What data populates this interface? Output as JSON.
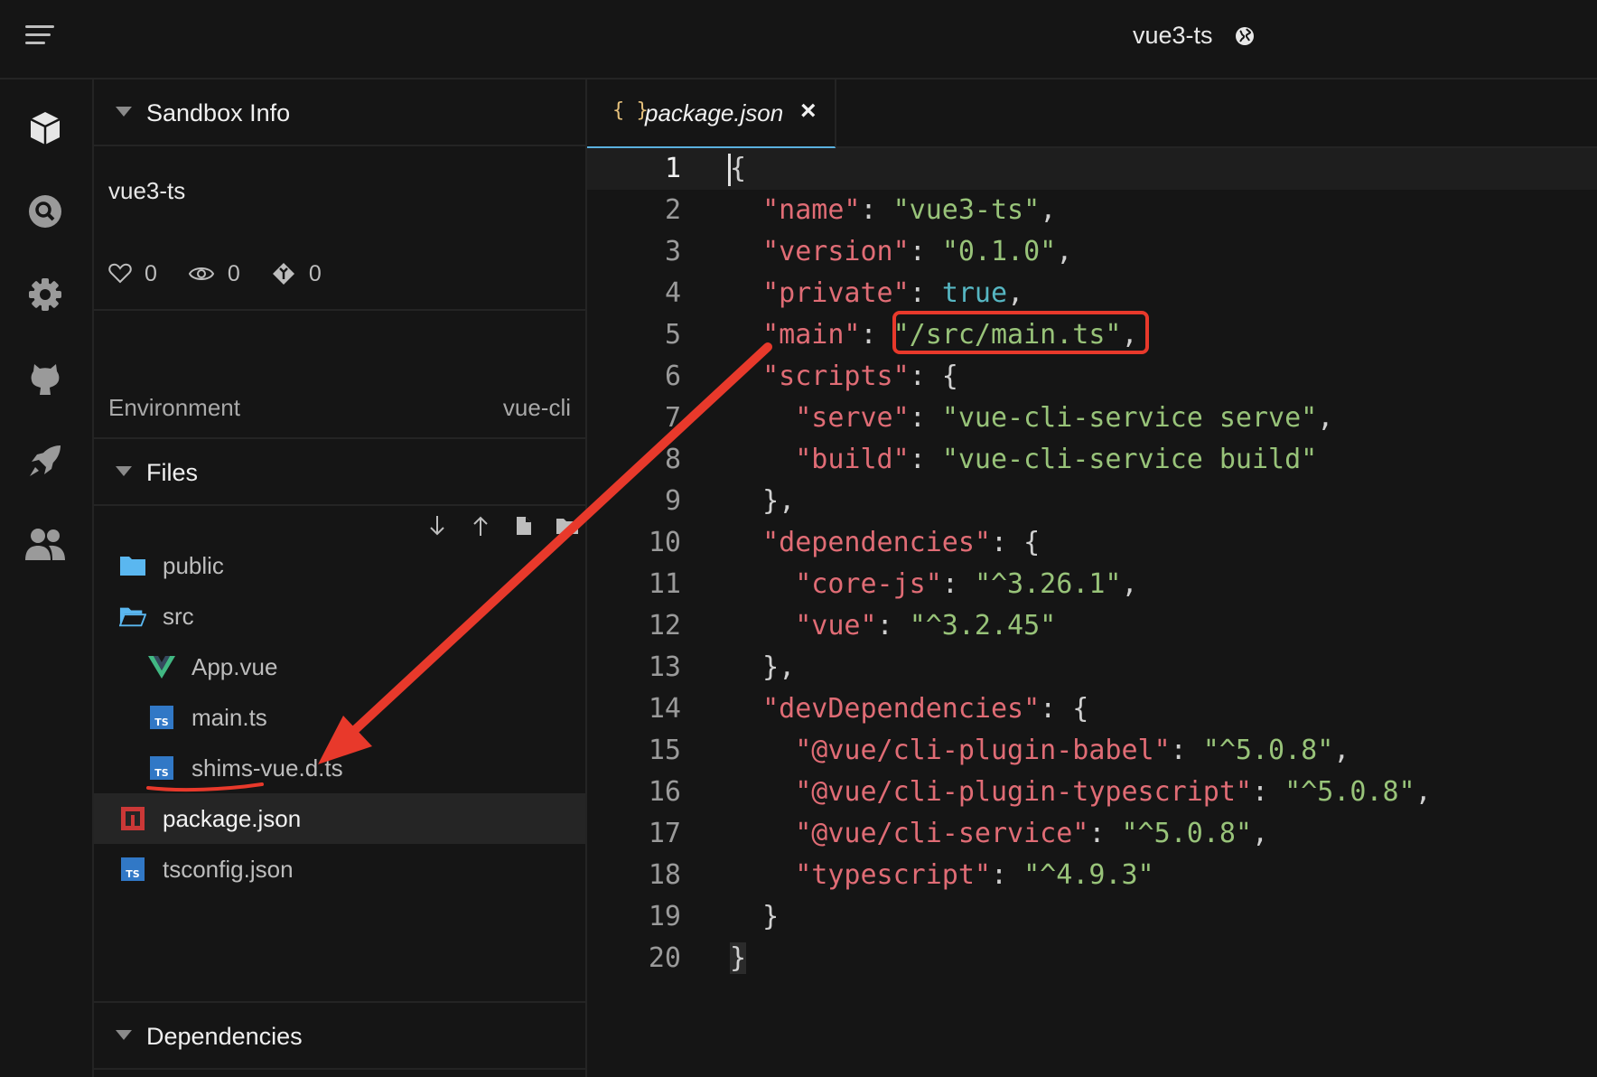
{
  "header": {
    "title": "vue3-ts"
  },
  "sidebar": {
    "sandbox_info": {
      "heading": "Sandbox Info",
      "project_name": "vue3-ts",
      "likes": "0",
      "views": "0",
      "forks": "0",
      "environment_label": "Environment",
      "environment_value": "vue-cli"
    },
    "files": {
      "heading": "Files",
      "items": [
        {
          "name": "public",
          "type": "folder"
        },
        {
          "name": "src",
          "type": "folder-open"
        },
        {
          "name": "App.vue",
          "type": "vue"
        },
        {
          "name": "main.ts",
          "type": "ts"
        },
        {
          "name": "shims-vue.d.ts",
          "type": "ts"
        },
        {
          "name": "package.json",
          "type": "npm",
          "selected": true
        },
        {
          "name": "tsconfig.json",
          "type": "ts"
        }
      ]
    },
    "dependencies": {
      "heading": "Dependencies"
    }
  },
  "editor": {
    "tab": {
      "label": "package.json",
      "icon": "{ }",
      "close": "×"
    },
    "lines": [
      {
        "n": "1",
        "parts": [
          [
            "p",
            "{"
          ]
        ]
      },
      {
        "n": "2",
        "parts": [
          [
            "p",
            "  "
          ],
          [
            "k",
            "\"name\""
          ],
          [
            "p",
            ": "
          ],
          [
            "s",
            "\"vue3-ts\""
          ],
          [
            "p",
            ","
          ]
        ]
      },
      {
        "n": "3",
        "parts": [
          [
            "p",
            "  "
          ],
          [
            "k",
            "\"version\""
          ],
          [
            "p",
            ": "
          ],
          [
            "s",
            "\"0.1.0\""
          ],
          [
            "p",
            ","
          ]
        ]
      },
      {
        "n": "4",
        "parts": [
          [
            "p",
            "  "
          ],
          [
            "k",
            "\"private\""
          ],
          [
            "p",
            ": "
          ],
          [
            "b",
            "true"
          ],
          [
            "p",
            ","
          ]
        ]
      },
      {
        "n": "5",
        "parts": [
          [
            "p",
            "  "
          ],
          [
            "k",
            "\"main\""
          ],
          [
            "p",
            ": "
          ],
          [
            "s",
            "\"/src/main.ts\""
          ],
          [
            "p",
            ","
          ]
        ]
      },
      {
        "n": "6",
        "parts": [
          [
            "p",
            "  "
          ],
          [
            "k",
            "\"scripts\""
          ],
          [
            "p",
            ": {"
          ]
        ]
      },
      {
        "n": "7",
        "parts": [
          [
            "p",
            "    "
          ],
          [
            "k",
            "\"serve\""
          ],
          [
            "p",
            ": "
          ],
          [
            "s",
            "\"vue-cli-service serve\""
          ],
          [
            "p",
            ","
          ]
        ]
      },
      {
        "n": "8",
        "parts": [
          [
            "p",
            "    "
          ],
          [
            "k",
            "\"build\""
          ],
          [
            "p",
            ": "
          ],
          [
            "s",
            "\"vue-cli-service build\""
          ]
        ]
      },
      {
        "n": "9",
        "parts": [
          [
            "p",
            "  },"
          ]
        ]
      },
      {
        "n": "10",
        "parts": [
          [
            "p",
            "  "
          ],
          [
            "k",
            "\"dependencies\""
          ],
          [
            "p",
            ": {"
          ]
        ]
      },
      {
        "n": "11",
        "parts": [
          [
            "p",
            "    "
          ],
          [
            "k",
            "\"core-js\""
          ],
          [
            "p",
            ": "
          ],
          [
            "s",
            "\"^3.26.1\""
          ],
          [
            "p",
            ","
          ]
        ]
      },
      {
        "n": "12",
        "parts": [
          [
            "p",
            "    "
          ],
          [
            "k",
            "\"vue\""
          ],
          [
            "p",
            ": "
          ],
          [
            "s",
            "\"^3.2.45\""
          ]
        ]
      },
      {
        "n": "13",
        "parts": [
          [
            "p",
            "  },"
          ]
        ]
      },
      {
        "n": "14",
        "parts": [
          [
            "p",
            "  "
          ],
          [
            "k",
            "\"devDependencies\""
          ],
          [
            "p",
            ": {"
          ]
        ]
      },
      {
        "n": "15",
        "parts": [
          [
            "p",
            "    "
          ],
          [
            "k",
            "\"@vue/cli-plugin-babel\""
          ],
          [
            "p",
            ": "
          ],
          [
            "s",
            "\"^5.0.8\""
          ],
          [
            "p",
            ","
          ]
        ]
      },
      {
        "n": "16",
        "parts": [
          [
            "p",
            "    "
          ],
          [
            "k",
            "\"@vue/cli-plugin-typescript\""
          ],
          [
            "p",
            ": "
          ],
          [
            "s",
            "\"^5.0.8\""
          ],
          [
            "p",
            ","
          ]
        ]
      },
      {
        "n": "17",
        "parts": [
          [
            "p",
            "    "
          ],
          [
            "k",
            "\"@vue/cli-service\""
          ],
          [
            "p",
            ": "
          ],
          [
            "s",
            "\"^5.0.8\""
          ],
          [
            "p",
            ","
          ]
        ]
      },
      {
        "n": "18",
        "parts": [
          [
            "p",
            "    "
          ],
          [
            "k",
            "\"typescript\""
          ],
          [
            "p",
            ": "
          ],
          [
            "s",
            "\"^4.9.3\""
          ]
        ]
      },
      {
        "n": "19",
        "parts": [
          [
            "p",
            "  }"
          ]
        ]
      },
      {
        "n": "20",
        "parts": [
          [
            "p",
            "}"
          ]
        ]
      }
    ]
  },
  "colors": {
    "key": "#e06c75",
    "string": "#98c379",
    "boolean": "#56b6c2",
    "annotation": "#e8392b",
    "tab_underline": "#5ab0de"
  }
}
